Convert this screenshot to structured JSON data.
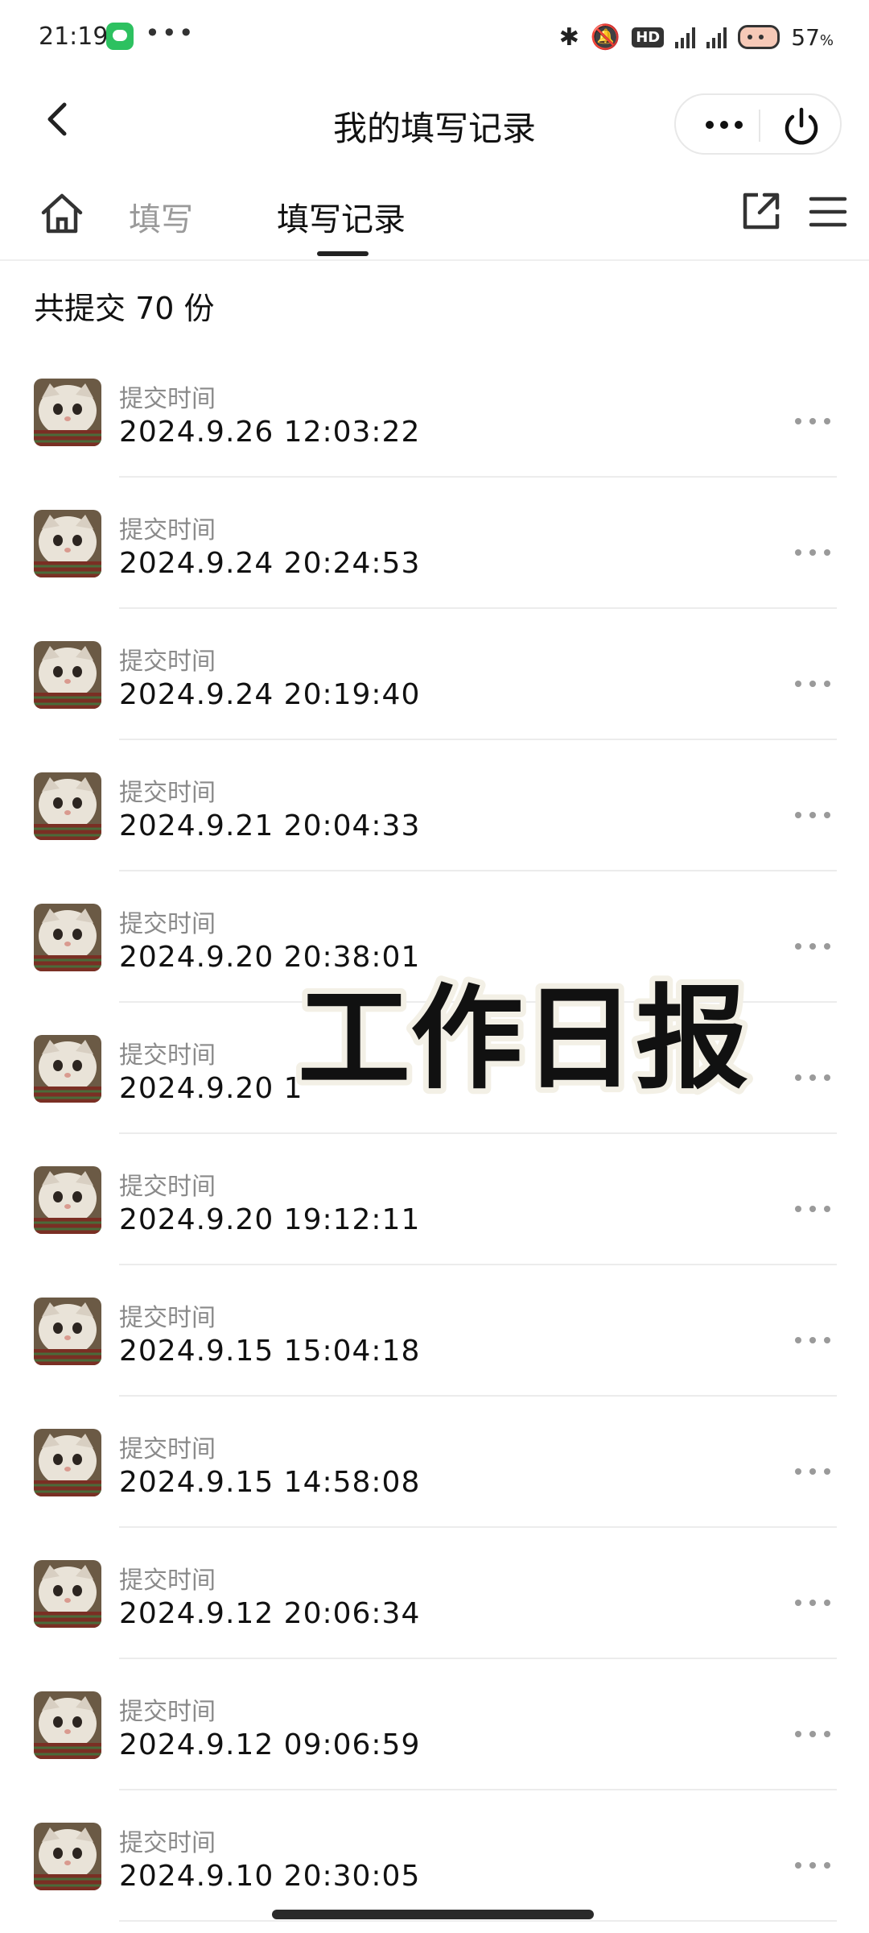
{
  "status_bar": {
    "time": "21:19",
    "dots": "•••",
    "battery": "57",
    "hd_label": "HD"
  },
  "header": {
    "title": "我的填写记录"
  },
  "tabs": {
    "fill": "填写",
    "records": "填写记录"
  },
  "summary": "共提交 70 份",
  "records": [
    {
      "label": "提交时间",
      "time": "2024.9.26 12:03:22"
    },
    {
      "label": "提交时间",
      "time": "2024.9.24 20:24:53"
    },
    {
      "label": "提交时间",
      "time": "2024.9.24 20:19:40"
    },
    {
      "label": "提交时间",
      "time": "2024.9.21 20:04:33"
    },
    {
      "label": "提交时间",
      "time": "2024.9.20 20:38:01"
    },
    {
      "label": "提交时间",
      "time": "2024.9.20 1"
    },
    {
      "label": "提交时间",
      "time": "2024.9.20 19:12:11"
    },
    {
      "label": "提交时间",
      "time": "2024.9.15 15:04:18"
    },
    {
      "label": "提交时间",
      "time": "2024.9.15 14:58:08"
    },
    {
      "label": "提交时间",
      "time": "2024.9.12 20:06:34"
    },
    {
      "label": "提交时间",
      "time": "2024.9.12 09:06:59"
    },
    {
      "label": "提交时间",
      "time": "2024.9.10 20:30:05"
    }
  ],
  "overlay_text": "工作日报"
}
